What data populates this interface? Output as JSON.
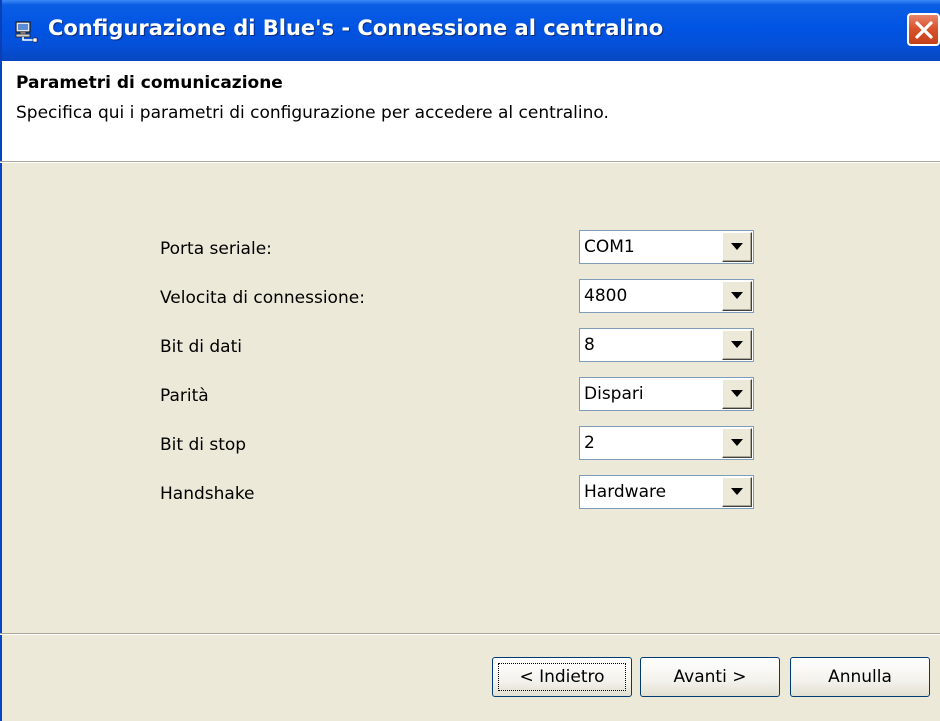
{
  "window": {
    "title": "Configurazione di Blue's - Connessione al centralino",
    "icon": "computer-network-icon",
    "close_icon": "close-icon"
  },
  "header": {
    "title": "Parametri di comunicazione",
    "subtitle": "Specifica qui i parametri di configurazione per accedere al centralino."
  },
  "fields": [
    {
      "label": "Porta seriale:",
      "value": "COM1"
    },
    {
      "label": "Velocita di connessione:",
      "value": "4800"
    },
    {
      "label": "Bit di dati",
      "value": "8"
    },
    {
      "label": "Parità",
      "value": "Dispari"
    },
    {
      "label": "Bit di stop",
      "value": "2"
    },
    {
      "label": "Handshake",
      "value": "Hardware"
    }
  ],
  "buttons": {
    "back": "< Indietro",
    "next": "Avanti >",
    "cancel": "Annulla"
  },
  "colors": {
    "titlebar": "#0054e3",
    "panel": "#ece9d8",
    "close": "#d9532c"
  }
}
